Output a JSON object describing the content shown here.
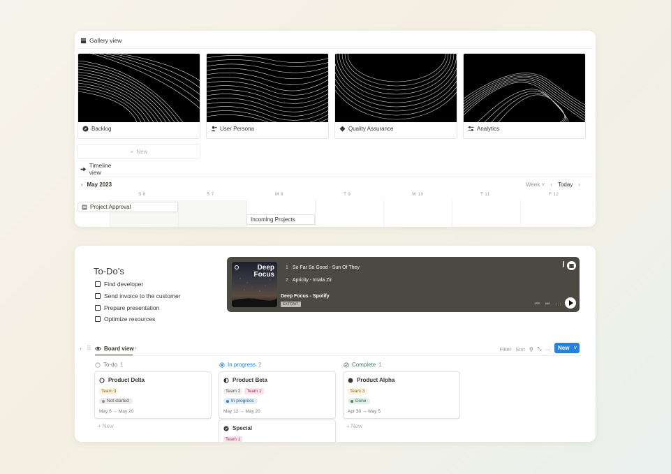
{
  "gallery": {
    "tab_label": "Gallery view",
    "items": [
      {
        "title": "Backlog",
        "icon": "compass-icon"
      },
      {
        "title": "User Persona",
        "icon": "add-user-icon"
      },
      {
        "title": "Quality Assurance",
        "icon": "diamond-icon"
      },
      {
        "title": "Analytics",
        "icon": "sliders-icon"
      }
    ],
    "new_label": "New"
  },
  "timeline": {
    "tab_label": "Timeline view",
    "month": "May 2023",
    "scale": "Week",
    "today": "Today",
    "days": [
      "S 6",
      "S 7",
      "M 8",
      "T 9",
      "W 10",
      "T 11",
      "F 12"
    ],
    "bars": [
      {
        "label": "Project Approval"
      },
      {
        "label": "Incoming Projects"
      }
    ]
  },
  "todos": {
    "title": "To-Do’s",
    "items": [
      "Find developer",
      "Send invoice to the customer",
      "Prepare presentation",
      "Optimize resources"
    ]
  },
  "spotify": {
    "art_title_1": "Deep",
    "art_title_2": "Focus",
    "tracks": [
      {
        "n": "1",
        "title": "So Far So Good - Sun Of They"
      },
      {
        "n": "2",
        "title": "Apricity - Imala Zir"
      }
    ],
    "playlist": "Deep Focus - Spotify",
    "badge": "EXTRAIT"
  },
  "board": {
    "tab_label": "Board view",
    "filter": "Filter",
    "sort": "Sort",
    "new_label": "New",
    "columns": [
      {
        "name": "To-do",
        "count": "1",
        "color": "#9b9a97",
        "cards": [
          {
            "title": "Product Delta",
            "tags": [
              "Team 3"
            ],
            "status": "Not started",
            "dates": "May 6 → May 20"
          }
        ]
      },
      {
        "name": "In progress",
        "count": "2",
        "color": "#2383e2",
        "cards": [
          {
            "title": "Product Beta",
            "tags": [
              "Team 2",
              "Team 1"
            ],
            "status": "In progress",
            "dates": "May 12 → May 20"
          },
          {
            "title": "Special",
            "tags": [
              "Team 1"
            ]
          }
        ]
      },
      {
        "name": "Complete",
        "count": "1",
        "color": "#448361",
        "cards": [
          {
            "title": "Product Alpha",
            "tags": [
              "Team 3"
            ],
            "status": "Done",
            "dates": "Apr 30 → May 5"
          }
        ]
      }
    ],
    "new_card_label": "New"
  }
}
